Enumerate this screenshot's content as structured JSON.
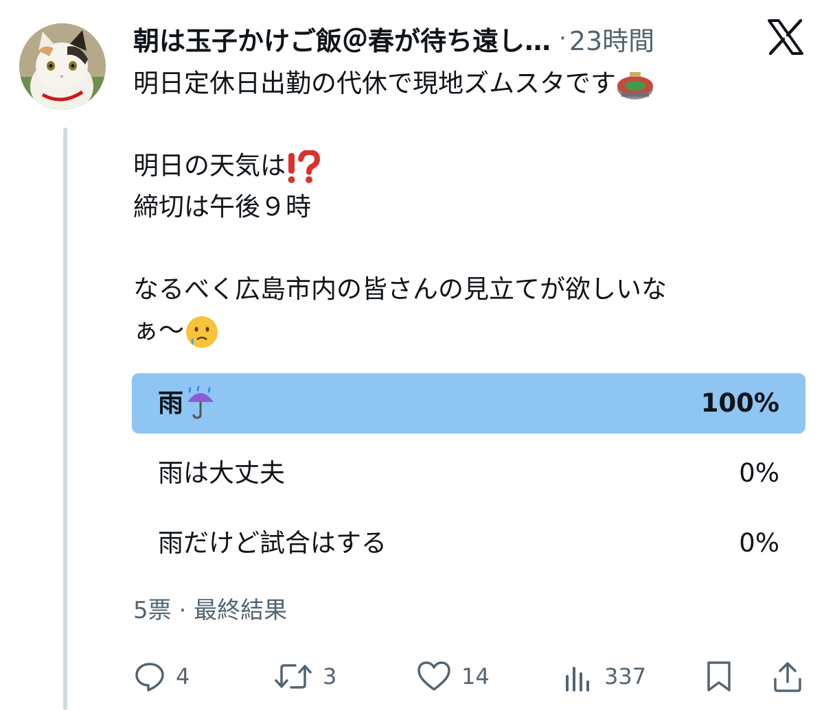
{
  "tweet": {
    "display_name": "朝は玉子かけご飯＠春が待ち遠し…",
    "separator": "·",
    "time": "23時間",
    "lines": [
      "明日定休日出勤の代休で現地ズムスタです",
      "",
      "明日の天気は",
      "締切は午後９時",
      "",
      "なるべく広島市内の皆さんの見立てが欲しいな",
      "ぁ〜"
    ],
    "emoji_icons": [
      "stadium-icon",
      "exclamation-question-icon",
      "crying-face-icon"
    ]
  },
  "poll": {
    "options": [
      {
        "label": "雨",
        "icon": "umbrella-rain-icon",
        "percent_text": "100%",
        "share": 1.0,
        "winner": true
      },
      {
        "label": "雨は大丈夫",
        "percent_text": "0%",
        "share": 0.0,
        "winner": false
      },
      {
        "label": "雨だけど試合はする",
        "percent_text": "0%",
        "share": 0.0,
        "winner": false
      }
    ],
    "votes": "5票",
    "separator": "·",
    "status": "最終結果"
  },
  "actions": {
    "reply_count": "4",
    "retweet_count": "3",
    "like_count": "14",
    "view_count": "337"
  },
  "colors": {
    "poll_fill": "#8ec5f2",
    "muted": "#536471",
    "thread_line": "#cfd9de"
  }
}
